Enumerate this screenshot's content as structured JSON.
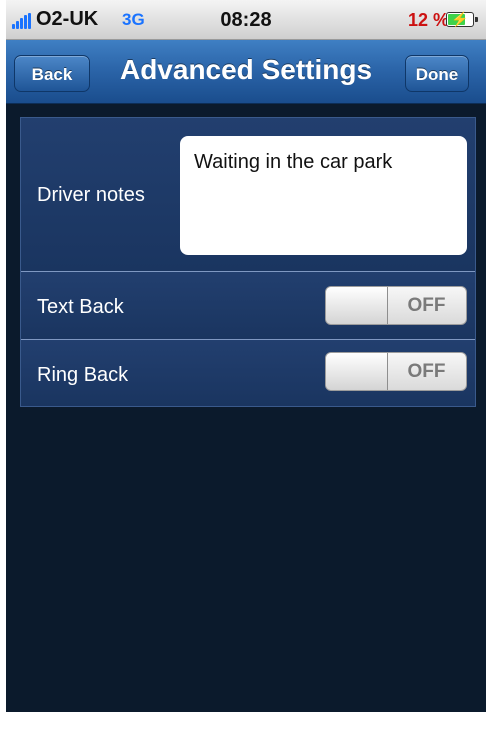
{
  "status_bar": {
    "carrier": "O2-UK",
    "network": "3G",
    "time": "08:28",
    "battery_percent": "12 %",
    "battery_level": 0.12,
    "charging_icon": "bolt-icon"
  },
  "nav": {
    "back_label": "Back",
    "title": "Advanced Settings",
    "done_label": "Done"
  },
  "settings": {
    "driver_notes": {
      "label": "Driver notes",
      "value": "Waiting in the car park"
    },
    "text_back": {
      "label": "Text Back",
      "state": "OFF"
    },
    "ring_back": {
      "label": "Ring Back",
      "state": "OFF"
    }
  },
  "colors": {
    "nav_bar": "#2a63a7",
    "background": "#0b1a2c",
    "row_background": "#1f3a68",
    "network_text": "#1a73ff",
    "battery_text": "#cc1111"
  }
}
